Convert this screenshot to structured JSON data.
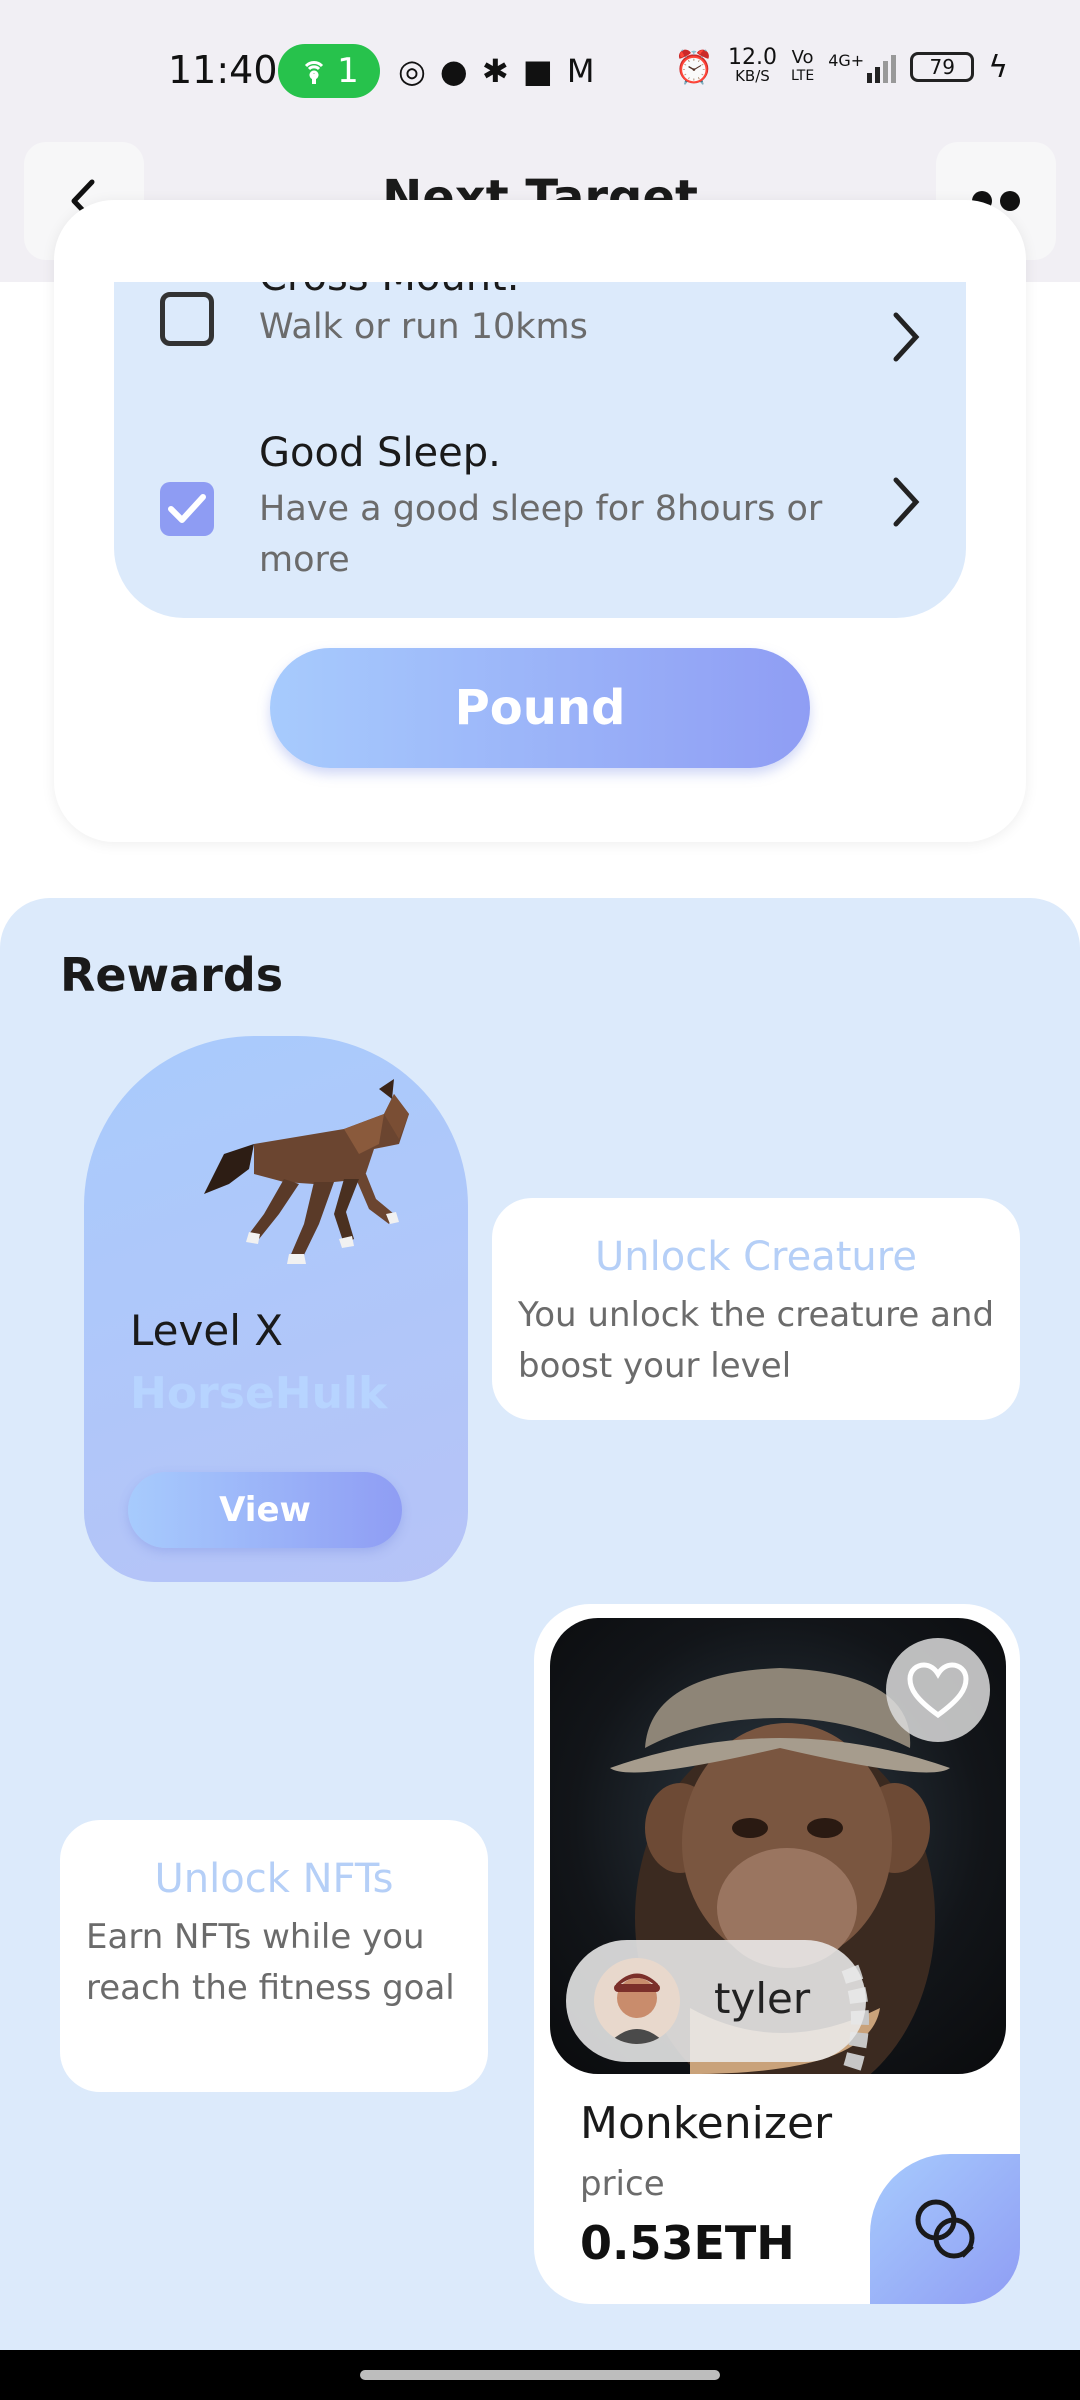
{
  "status_bar": {
    "time": "11:40",
    "hotspot_count": "1",
    "net_speed_value": "12.0",
    "net_speed_unit": "KB/S",
    "volte_top": "Vo",
    "volte_bottom": "LTE",
    "network": "4G+",
    "battery": "79"
  },
  "header": {
    "title": "Next Target"
  },
  "tasks": [
    {
      "title": "Cross Mount.",
      "description": "Walk or run 10kms",
      "checked": false
    },
    {
      "title": "Good Sleep.",
      "description": "Have a good sleep for 8hours or more",
      "checked": true
    }
  ],
  "pound_button": "Pound",
  "rewards": {
    "title": "Rewards",
    "creature": {
      "level": "Level X",
      "name": "HorseHulk",
      "view_label": "View"
    },
    "unlock_creature": {
      "title": "Unlock Creature",
      "text": "You unlock the creature and boost your level"
    },
    "unlock_nfts": {
      "title": "Unlock NFTs",
      "text": "Earn NFTs while you reach the fitness goal"
    },
    "nft": {
      "owner": "tyler",
      "name": "Monkenizer",
      "price_label": "price",
      "price": "0.53ETH"
    }
  },
  "colors": {
    "accent_gradient_start": "#a7cbfd",
    "accent_gradient_end": "#8f9df4",
    "panel_bg": "#dceafb",
    "checkbox_checked": "#8e9cf3"
  }
}
